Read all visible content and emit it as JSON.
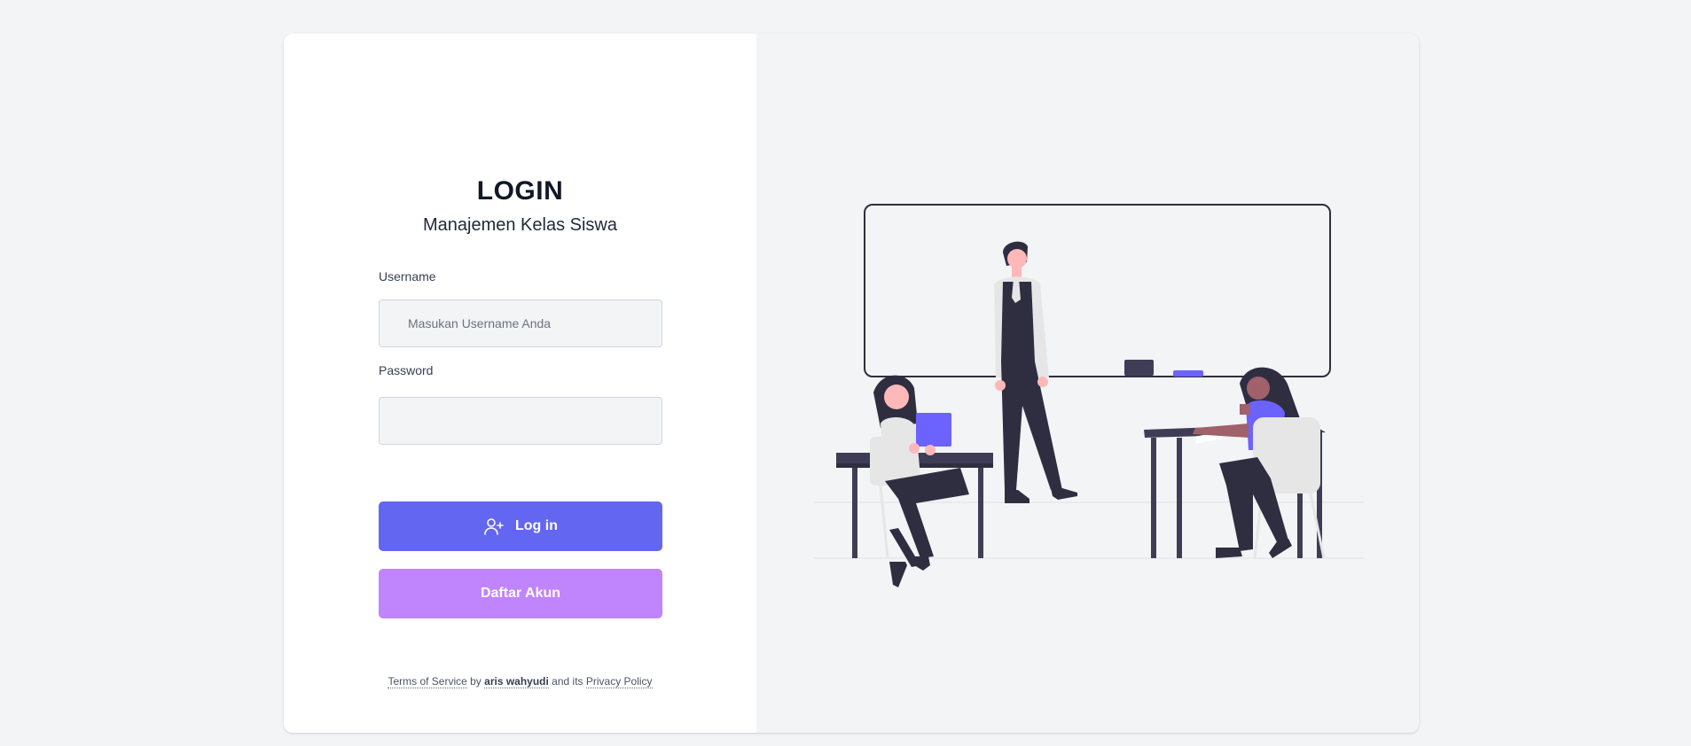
{
  "login": {
    "title": "LOGIN",
    "subtitle": "Manajemen Kelas Siswa",
    "username_label": "Username",
    "username_placeholder": "Masukan Username Anda",
    "username_value": "",
    "password_label": "Password",
    "password_value": "",
    "login_button": "Log in",
    "register_button": "Daftar Akun"
  },
  "footer": {
    "terms": "Terms of Service",
    "by": " by ",
    "author": "aris wahyudi",
    "and_its": " and its ",
    "privacy": "Privacy Policy"
  },
  "icons": {
    "login_button_icon": "user-plus-icon"
  },
  "colors": {
    "primary": "#6366f1",
    "secondary": "#c084fc",
    "background": "#f3f4f6",
    "card": "#ffffff",
    "dark": "#2f2e41"
  }
}
